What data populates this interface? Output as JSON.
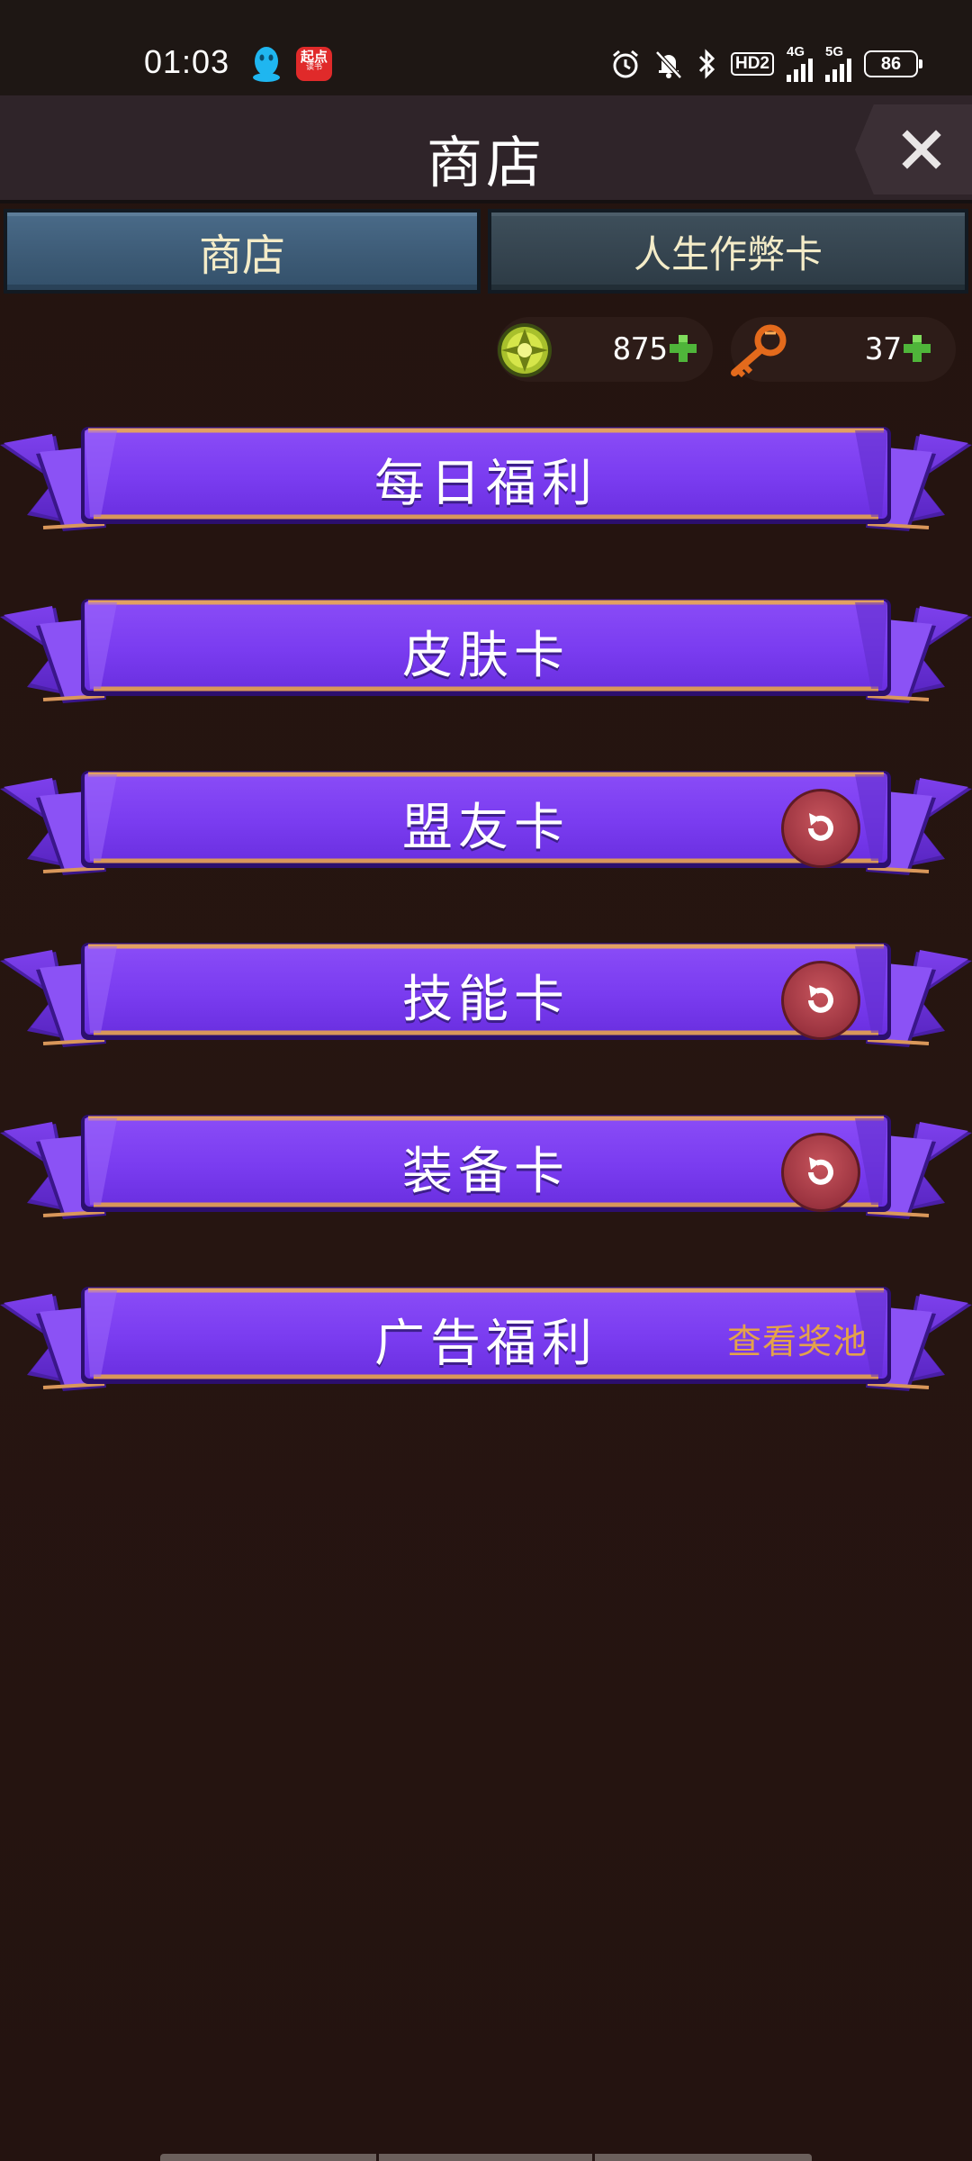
{
  "status_bar": {
    "time": "01:03",
    "app_badge_text": "起点",
    "app_badge_sub": "读书",
    "hd_label": "HD2",
    "net1": "4G",
    "net2": "5G",
    "battery": "86"
  },
  "header": {
    "title": "商店",
    "close_icon": "close-icon"
  },
  "tabs": [
    {
      "label": "商店",
      "active": true
    },
    {
      "label": "人生作弊卡",
      "active": false
    }
  ],
  "currency": {
    "coins": "875",
    "keys": "37"
  },
  "ribbons": [
    {
      "label": "每日福利"
    },
    {
      "label": "皮肤卡"
    },
    {
      "label": "盟友卡",
      "icon": "refresh-icon"
    },
    {
      "label": "技能卡",
      "icon": "refresh-icon"
    },
    {
      "label": "装备卡",
      "icon": "refresh-icon"
    },
    {
      "label": "广告福利",
      "side_text": "查看奖池"
    }
  ],
  "colors": {
    "background": "#241410",
    "ribbon_purple": "#7b3df2",
    "ribbon_edge": "#d9975a",
    "tab_active": "#43627f",
    "tab_inactive": "#36454f",
    "accent_orange": "#e4a24a"
  }
}
